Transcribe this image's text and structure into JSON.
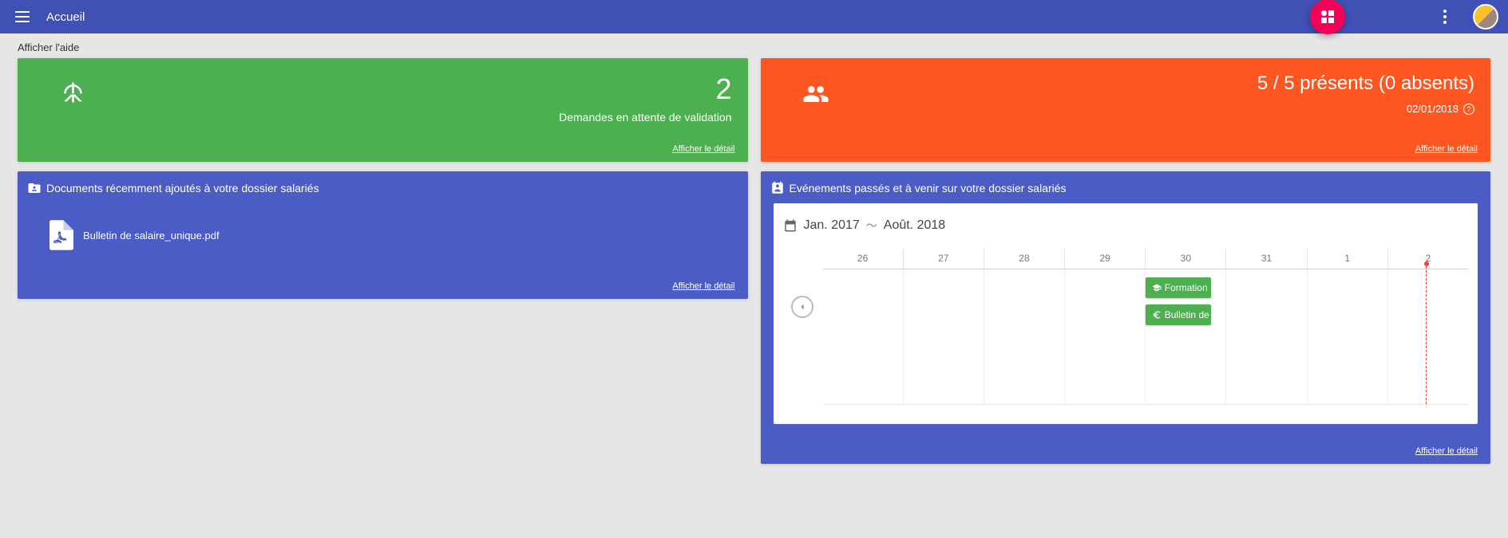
{
  "header": {
    "title": "Accueil"
  },
  "help_link": "Afficher l'aide",
  "detail_link": "Afficher  le détail",
  "cards": {
    "pending": {
      "count": "2",
      "label": "Demandes en attente de validation"
    },
    "presence": {
      "summary": "5 / 5 présents (0 absents)",
      "date": "02/01/2018"
    }
  },
  "docs_panel": {
    "title": "Documents récemment ajoutés à votre dossier salariés",
    "items": [
      {
        "name": "Bulletin de salaire_unique.pdf"
      }
    ]
  },
  "events_panel": {
    "title": "Evénements passés et à venir sur votre dossier salariés",
    "range_from": "Jan. 2017",
    "range_to": "Août. 2018",
    "days": [
      "26",
      "27",
      "28",
      "29",
      "30",
      "31",
      "1",
      "2"
    ],
    "events": [
      {
        "label": "Formation",
        "type": "formation"
      },
      {
        "label": "Bulletin de",
        "type": "bulletin"
      }
    ]
  }
}
